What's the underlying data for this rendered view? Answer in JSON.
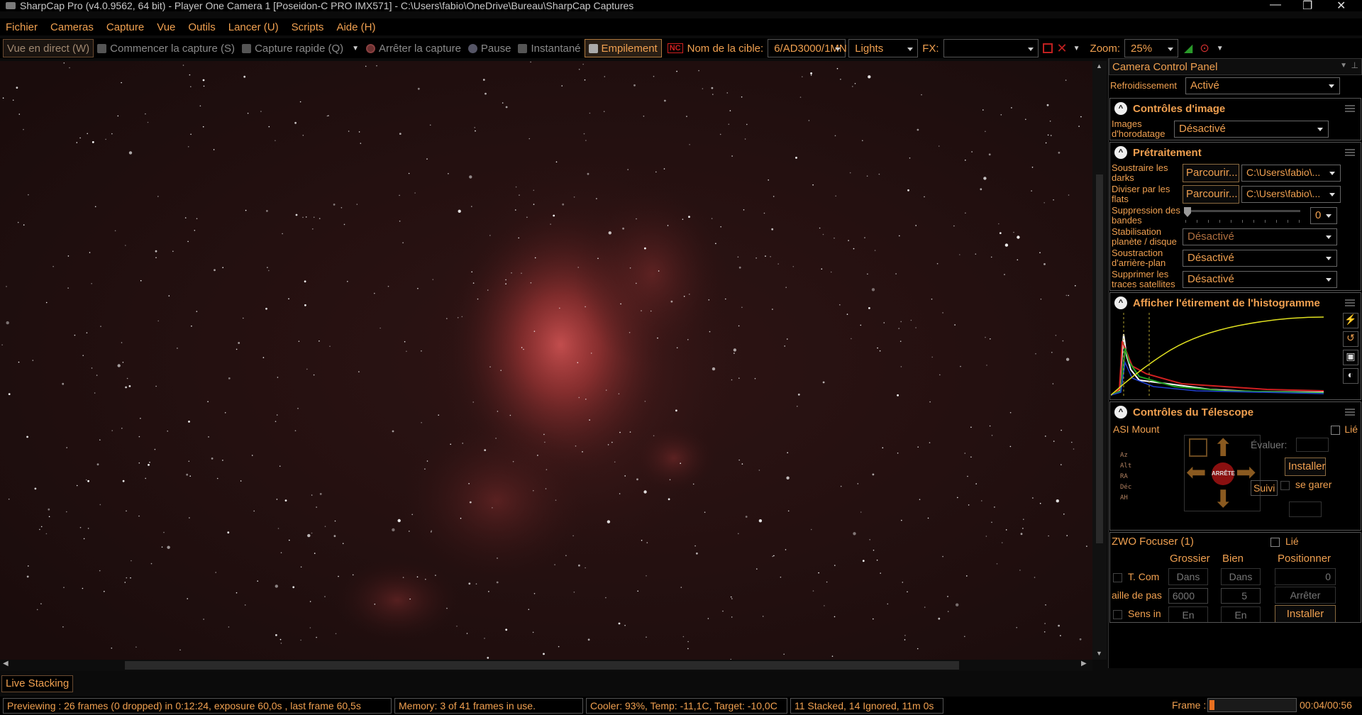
{
  "window": {
    "title": "SharpCap Pro (v4.0.9562, 64 bit) - Player One Camera 1 [Poseidon-C PRO IMX571] - C:\\Users\\fabio\\OneDrive\\Bureau\\SharpCap Captures",
    "minimize": "—",
    "maximize": "❐",
    "close": "✕"
  },
  "menu": [
    "Fichier",
    "Cameras",
    "Capture",
    "Vue",
    "Outils",
    "Lancer (U)",
    "Scripts",
    "Aide (H)"
  ],
  "toolbar": {
    "live_view": "Vue en direct (W)",
    "start_capture": "Commencer la capture (S)",
    "quick_capture": "Capture rapide (Q)",
    "stop_capture": "Arrêter la capture",
    "pause": "Pause",
    "snapshot": "Instantané",
    "stacking": "Empilement",
    "target_label": "Nom de la cible:",
    "target_value": "6/AD3000/1MN",
    "frame_type": "Lights",
    "fx_label": "FX:",
    "fx_value": "",
    "zoom_label": "Zoom:",
    "zoom_value": "25%"
  },
  "panel": {
    "title": "Camera Control Panel",
    "cooling": {
      "label": "Refroidissement",
      "value": "Activé"
    },
    "image_controls": {
      "title": "Contrôles d'image",
      "timestamp": {
        "label": "Images d'horodatage",
        "value": "Désactivé"
      }
    },
    "preprocessing": {
      "title": "Prétraitement",
      "darks": {
        "label": "Soustraire les darks",
        "browse": "Parcourir...",
        "path": "C:\\Users\\fabio\\..."
      },
      "flats": {
        "label": "Diviser par les flats",
        "browse": "Parcourir...",
        "path": "C:\\Users\\fabio\\..."
      },
      "banding": {
        "label": "Suppression des bandes",
        "value": "0"
      },
      "stabilisation": {
        "label": "Stabilisation planète / disque",
        "value": "Désactivé"
      },
      "background": {
        "label": "Soustraction d'arrière-plan",
        "value": "Désactivé"
      },
      "satellites": {
        "label": "Supprimer les traces satellites",
        "value": "Désactivé"
      }
    },
    "histogram": {
      "title": "Afficher l'étirement de l'histogramme"
    },
    "telescope": {
      "title": "Contrôles du Télescope",
      "mount": "ASI Mount",
      "linked": "Lié",
      "evaluate": "Évaluer:",
      "axes": [
        "Az",
        "Alt",
        "RA",
        "Déc",
        "AH"
      ],
      "stop": "ARRÊTE",
      "install": "Installer",
      "park": "se garer",
      "tracking": "Suivi"
    },
    "focuser": {
      "title": "ZWO Focuser (1)",
      "linked": "Lié",
      "cols": [
        "Grossier",
        "Bien",
        "Positionner"
      ],
      "tcomp": "T. Com",
      "in": "Dans",
      "position": "0",
      "step_label": "aille de pas",
      "coarse_step": "6000",
      "fine_step": "5",
      "stop": "Arrêter",
      "direction": "Sens in",
      "out": "En dehors",
      "install": "Installer"
    }
  },
  "live_stacking_tab": "Live Stacking",
  "status": {
    "preview": "Previewing : 26 frames (0 dropped) in 0:12:24, exposure 60,0s , last frame 60,5s",
    "memory": "Memory: 3 of 41 frames in use.",
    "cooler": "Cooler: 93%, Temp: -11,1C, Target: -10,0C",
    "stacked": "11 Stacked, 14 Ignored, 11m 0s",
    "frame_label": "Frame :",
    "frame_progress": 0.06,
    "time": "00:04/00:56"
  },
  "colors": {
    "accent": "#f0a050",
    "background": "#000000",
    "nebula": "#c04040"
  }
}
